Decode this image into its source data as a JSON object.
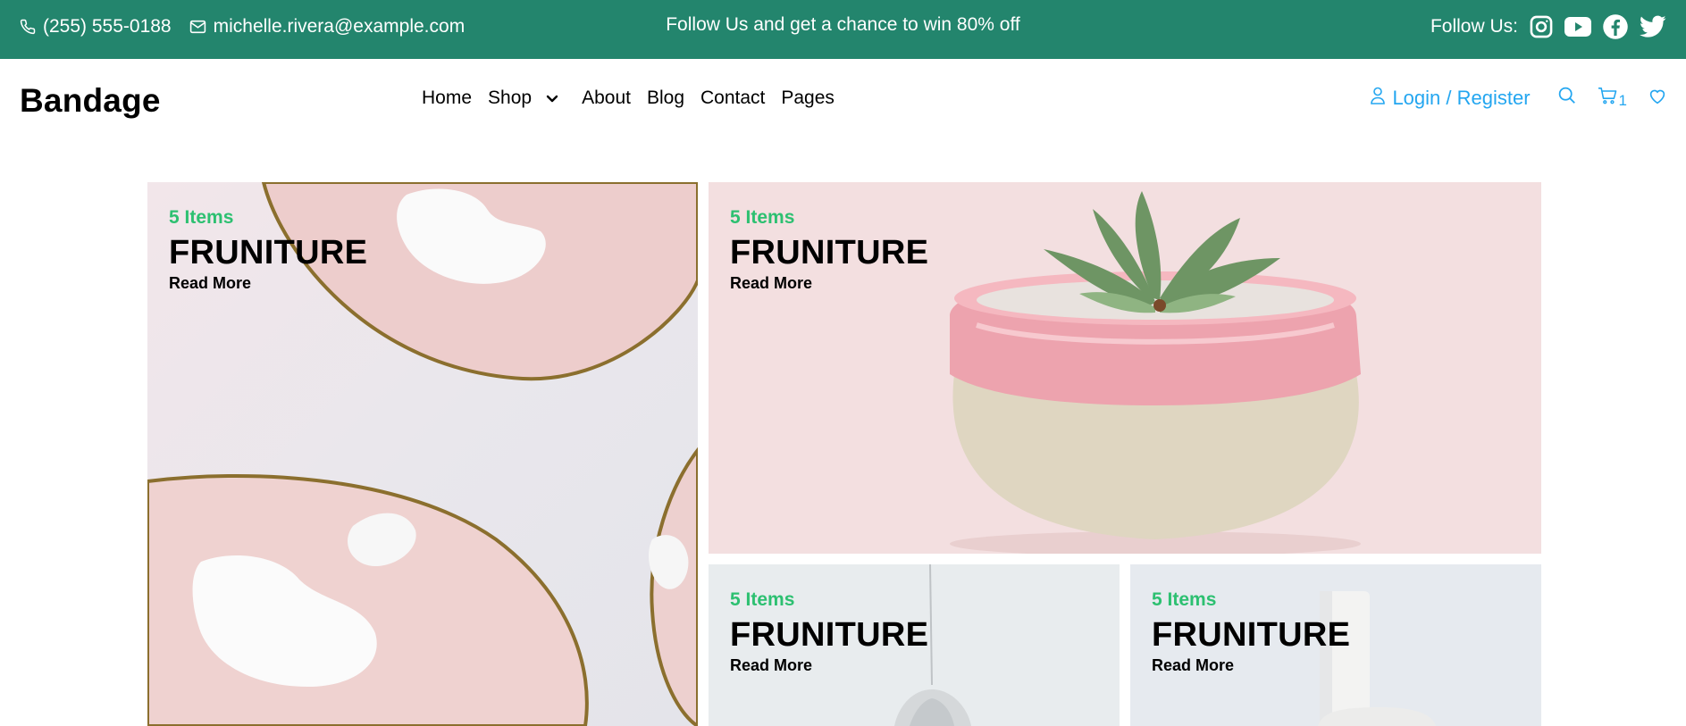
{
  "topbar": {
    "phone": "(255) 555-0188",
    "email": "michelle.rivera@example.com",
    "promo": "Follow Us and get a chance to win 80% off",
    "follow_label": "Follow Us:",
    "social_icons": [
      "instagram-icon",
      "youtube-icon",
      "facebook-icon",
      "twitter-icon"
    ]
  },
  "navbar": {
    "brand": "Bandage",
    "menu": {
      "home": "Home",
      "shop": "Shop",
      "about": "About",
      "blog": "Blog",
      "contact": "Contact",
      "pages": "Pages"
    },
    "login": "Login / Register",
    "cart_count": "1"
  },
  "cards": [
    {
      "count": "5 Items",
      "title": "FRUNITURE",
      "link": "Read More"
    },
    {
      "count": "5 Items",
      "title": "FRUNITURE",
      "link": "Read More"
    },
    {
      "count": "5 Items",
      "title": "FRUNITURE",
      "link": "Read More"
    },
    {
      "count": "5 Items",
      "title": "FRUNITURE",
      "link": "Read More"
    }
  ],
  "colors": {
    "topbar": "#23856D",
    "accent_blue": "#23A6F0",
    "accent_green": "#2DC071"
  }
}
